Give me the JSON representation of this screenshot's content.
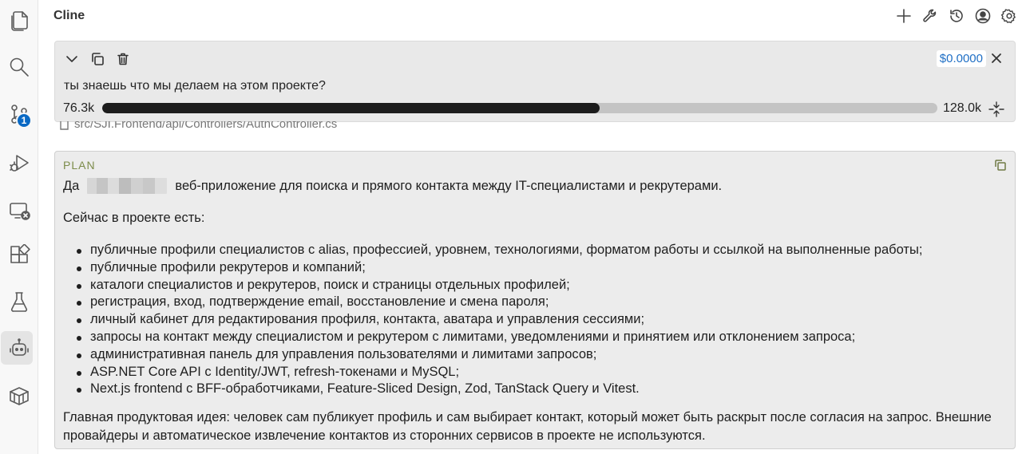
{
  "activity_bar": {
    "items": [
      {
        "name": "explorer-icon"
      },
      {
        "name": "search-icon"
      },
      {
        "name": "source-control-icon",
        "badge": "1"
      },
      {
        "name": "run-debug-icon"
      },
      {
        "name": "remote-explorer-icon"
      },
      {
        "name": "extensions-icon"
      },
      {
        "name": "testing-icon"
      },
      {
        "name": "cline-robot-icon",
        "active": true
      },
      {
        "name": "containers-icon"
      }
    ]
  },
  "header": {
    "title": "Cline",
    "actions": [
      "plus-icon",
      "wrench-icon",
      "history-icon",
      "account-icon",
      "settings-icon"
    ]
  },
  "task": {
    "text": "ты знаешь что мы делаем на этом проекте?",
    "cost": "$0.0000",
    "context_used": "76.3k",
    "context_max": "128.0k",
    "context_fraction": 0.596
  },
  "hidden_line": {
    "text": "src/SJI.Frontend/api/Controllers/AuthController.cs"
  },
  "plan": {
    "label": "PLAN",
    "intro_prefix": "Да",
    "intro_suffix": "веб-приложение для поиска и прямого контакта между IT-специалистами и рекрутерами.",
    "now_heading": "Сейчас в проекте есть:",
    "items": [
      "публичные профили специалистов с alias, профессией, уровнем, технологиями, форматом работы и ссылкой на выполненные работы;",
      "публичные профили рекрутеров и компаний;",
      "каталоги специалистов и рекрутеров, поиск и страницы отдельных профилей;",
      "регистрация, вход, подтверждение email, восстановление и смена пароля;",
      "личный кабинет для редактирования профиля, контакта, аватара и управления сессиями;",
      "запросы на контакт между специалистом и рекрутером с лимитами, уведомлениями и принятием или отклонением запроса;",
      "административная панель для управления пользователями и лимитами запросов;",
      "ASP.NET Core API с Identity/JWT, refresh-токенами и MySQL;",
      "Next.js frontend с BFF-обработчиками, Feature-Sliced Design, Zod, TanStack Query и Vitest."
    ],
    "idea": "Главная продуктовая идея: человек сам публикует профиль и сам выбирает контакт, который может быть раскрыт после согласия на запрос. Внешние провайдеры и автоматическое извлечение контактов из сторонних сервисов в проекте не используются."
  }
}
